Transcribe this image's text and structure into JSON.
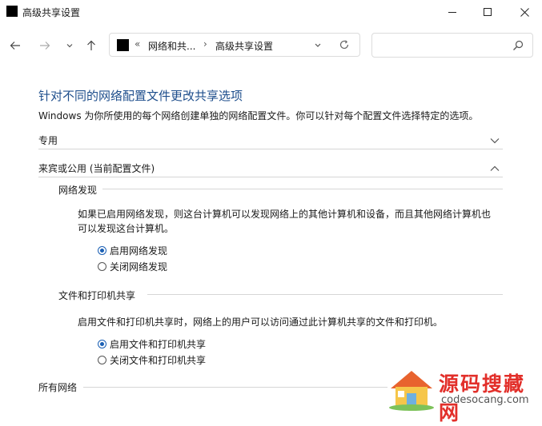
{
  "window": {
    "title": "高级共享设置"
  },
  "address": {
    "sep": "«",
    "crumb1": "网络和共...",
    "sep2": "›",
    "crumb2": "高级共享设置"
  },
  "search": {
    "placeholder": ""
  },
  "page": {
    "heading": "针对不同的网络配置文件更改共享选项",
    "description": "Windows 为你所使用的每个网络创建单独的网络配置文件。你可以针对每个配置文件选择特定的选项。"
  },
  "sections": {
    "private": {
      "label": "专用",
      "expanded": false
    },
    "public": {
      "label": "来宾或公用 (当前配置文件)",
      "expanded": true
    },
    "all": {
      "label": "所有网络"
    }
  },
  "discovery": {
    "heading": "网络发现",
    "text_line1": "如果已启用网络发现，则这台计算机可以发现网络上的其他计算机和设备，而且其他网络计算机也",
    "text_line2": "可以发现这台计算机。",
    "option_on": "启用网络发现",
    "option_off": "关闭网络发现",
    "selected": "on"
  },
  "sharing": {
    "heading": "文件和打印机共享",
    "text": "启用文件和打印机共享时，网络上的用户可以访问通过此计算机共享的文件和打印机。",
    "option_on": "启用文件和打印机共享",
    "option_off": "关闭文件和打印机共享",
    "selected": "on"
  },
  "watermark": {
    "brand": "源码搜藏网",
    "url": "codesocang.com"
  },
  "colors": {
    "accent": "#1a5fb4",
    "heading": "#1e4e8c",
    "watermark": "#e22f2a"
  }
}
